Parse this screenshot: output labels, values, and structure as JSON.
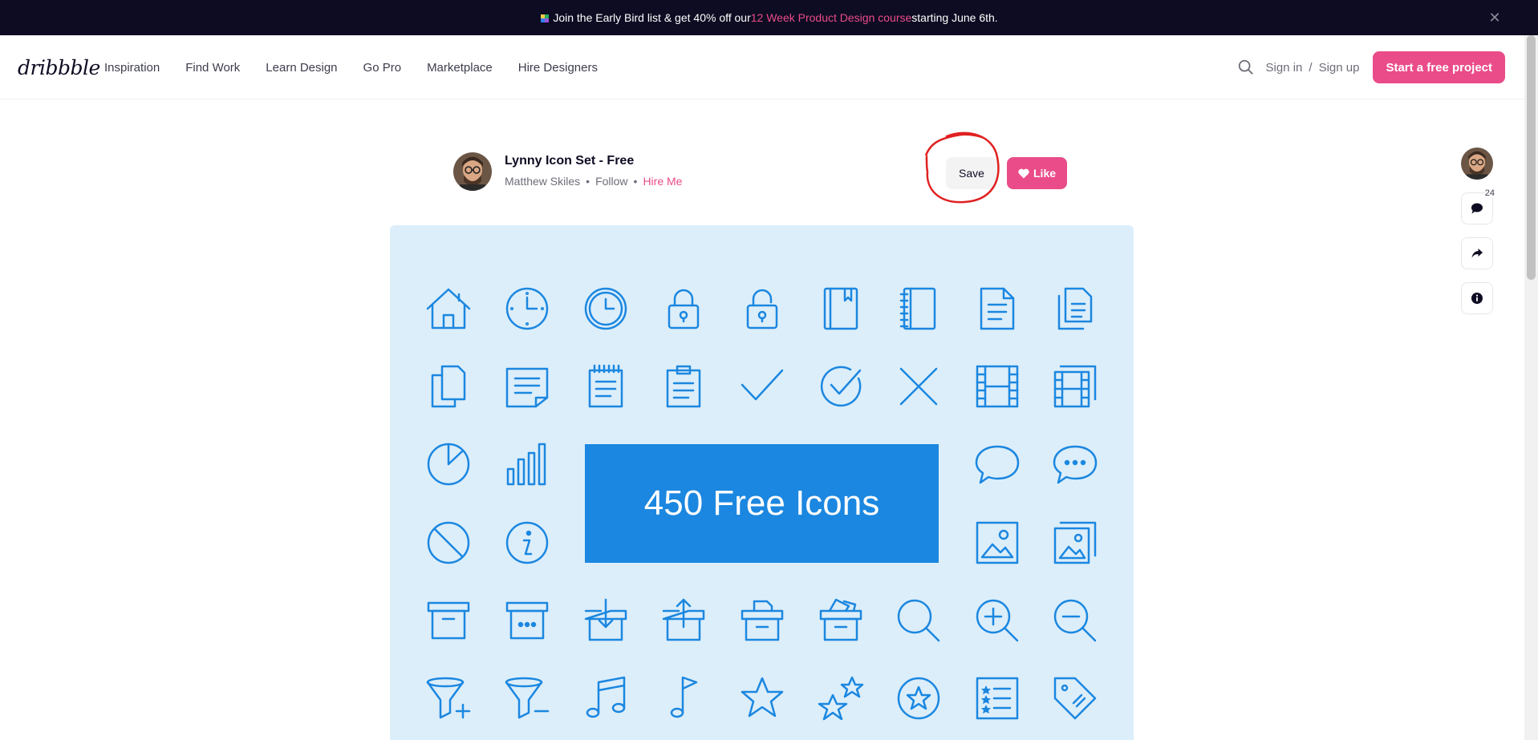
{
  "banner": {
    "text_before": "Join the Early Bird list & get 40% off our ",
    "highlight": "12 Week Product Design course",
    "text_after": " starting June 6th.",
    "close_label": "✕"
  },
  "nav": {
    "logo": "dribbble",
    "links": [
      "Inspiration",
      "Find Work",
      "Learn Design",
      "Go Pro",
      "Marketplace",
      "Hire Designers"
    ],
    "sign_in": "Sign in",
    "separator": "/",
    "sign_up": "Sign up",
    "cta": "Start a free project"
  },
  "shot": {
    "title": "Lynny Icon Set - Free",
    "author": "Matthew Skiles",
    "follow": "Follow",
    "hire": "Hire Me",
    "dot": "•",
    "save_label": "Save",
    "like_label": "Like",
    "promo_text": "450 Free Icons"
  },
  "rail": {
    "comment_count": "24"
  },
  "colors": {
    "brand_pink": "#ea4c89",
    "banner_bg": "#0d0c22",
    "canvas_bg": "#dceefa",
    "icon_blue": "#1b87e0",
    "annotation_red": "#e02020"
  },
  "icons": [
    "home-icon",
    "clock-icon",
    "clock-filled-icon",
    "lock-icon",
    "unlock-icon",
    "book-icon",
    "notebook-icon",
    "document-icon",
    "documents-icon",
    "copy-icon",
    "note-icon",
    "notepad-icon",
    "clipboard-icon",
    "checkmark-icon",
    "check-circle-icon",
    "close-x-icon",
    "film-icon",
    "films-icon",
    "pie-chart-icon",
    "bar-chart-icon",
    "speech-bubble-icon",
    "chat-dots-icon",
    "blocked-icon",
    "info-icon",
    "image-icon",
    "images-icon",
    "archive-icon",
    "archive-dots-icon",
    "box-download-icon",
    "box-upload-icon",
    "box-files-icon",
    "box-tickets-icon",
    "search-icon",
    "zoom-in-icon",
    "zoom-out-icon",
    "filter-add-icon",
    "filter-remove-icon",
    "music-notes-icon",
    "music-note-icon",
    "star-icon",
    "stars-icon",
    "star-circle-icon",
    "rated-list-icon",
    "tag-icon"
  ]
}
